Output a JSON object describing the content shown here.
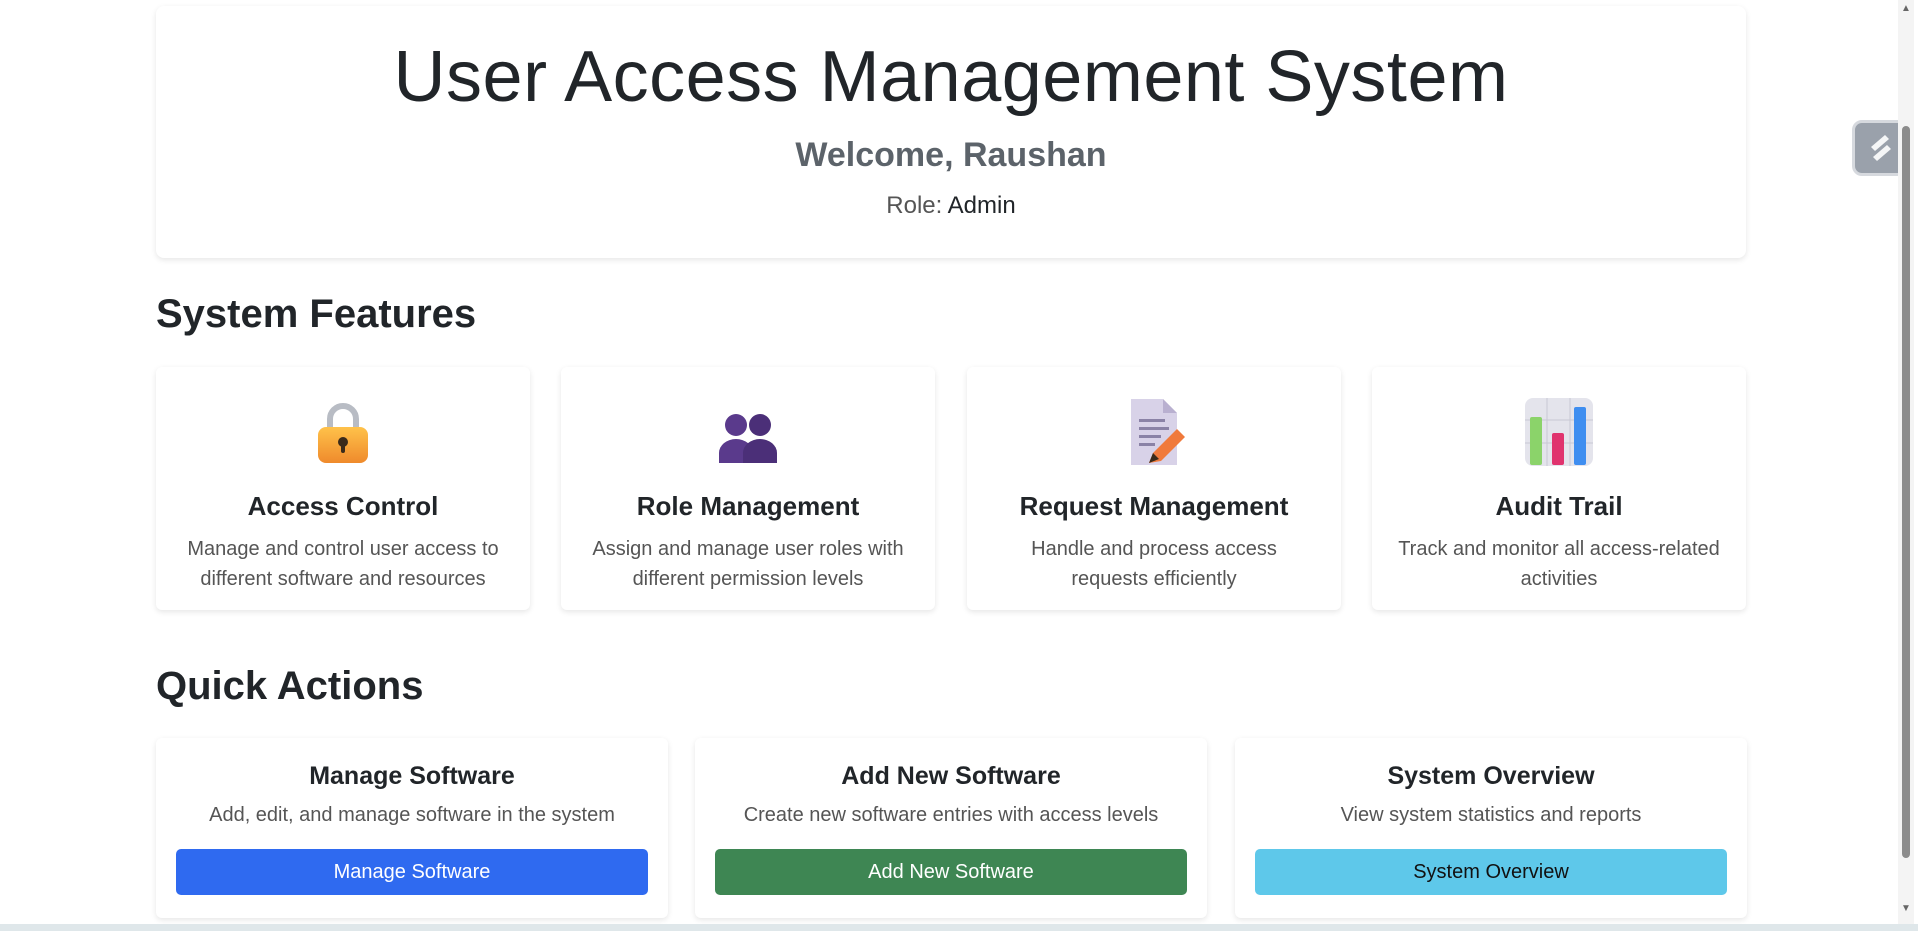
{
  "hero": {
    "title": "User Access Management System",
    "welcome": "Welcome, Raushan",
    "role_label": "Role:",
    "role_value": "Admin"
  },
  "features": {
    "heading": "System Features",
    "items": [
      {
        "icon": "lock-icon",
        "title": "Access Control",
        "description": "Manage and control user access to different software and resources"
      },
      {
        "icon": "users-icon",
        "title": "Role Management",
        "description": "Assign and manage user roles with different permission levels"
      },
      {
        "icon": "document-edit-icon",
        "title": "Request Management",
        "description": "Handle and process access requests efficiently"
      },
      {
        "icon": "bar-chart-icon",
        "title": "Audit Trail",
        "description": "Track and monitor all access-related activities"
      }
    ]
  },
  "quick_actions": {
    "heading": "Quick Actions",
    "items": [
      {
        "title": "Manage Software",
        "description": "Add, edit, and manage software in the system",
        "button_label": "Manage Software",
        "button_color": "#2f6af0",
        "button_text_color": "#ffffff"
      },
      {
        "title": "Add New Software",
        "description": "Create new software entries with access levels",
        "button_label": "Add New Software",
        "button_color": "#3e8653",
        "button_text_color": "#ffffff"
      },
      {
        "title": "System Overview",
        "description": "View system statistics and reports",
        "button_label": "System Overview",
        "button_color": "#5ec8ea",
        "button_text_color": "#111111"
      }
    ]
  }
}
